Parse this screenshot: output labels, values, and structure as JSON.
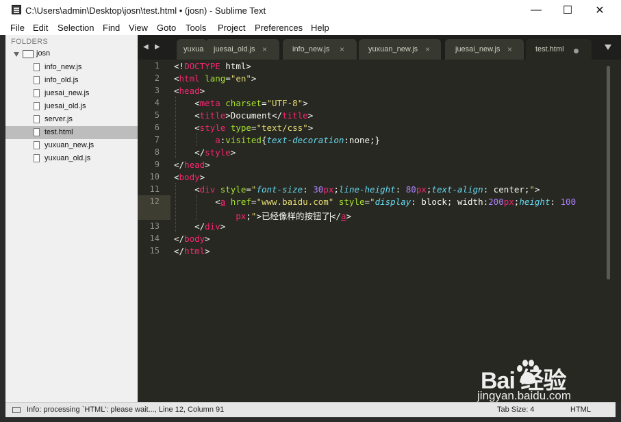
{
  "window": {
    "title": "C:\\Users\\admin\\Desktop\\josn\\test.html • (josn) - Sublime Text",
    "minimize": "—",
    "maximize": "☐",
    "close": "✕"
  },
  "menu": [
    "File",
    "Edit",
    "Selection",
    "Find",
    "View",
    "Goto",
    "Tools",
    "Project",
    "Preferences",
    "Help"
  ],
  "sidebar": {
    "header": "FOLDERS",
    "root": "josn",
    "files": [
      {
        "name": "info_new.js"
      },
      {
        "name": "info_old.js"
      },
      {
        "name": "juesai_new.js"
      },
      {
        "name": "juesai_old.js"
      },
      {
        "name": "server.js"
      },
      {
        "name": "test.html",
        "selected": true
      },
      {
        "name": "yuxuan_new.js"
      },
      {
        "name": "yuxuan_old.js"
      }
    ]
  },
  "tabs": [
    {
      "label": "yuxua",
      "close": ""
    },
    {
      "label": "juesai_old.js",
      "close": "×"
    },
    {
      "label": "info_new.js",
      "close": "×"
    },
    {
      "label": "yuxuan_new.js",
      "close": "×"
    },
    {
      "label": "juesai_new.js",
      "close": "×"
    },
    {
      "label": "test.html",
      "close": "",
      "active": true,
      "dirty": true
    }
  ],
  "tab_nav": {
    "prev": "◀",
    "next": "▶"
  },
  "editor": {
    "line_numbers": [
      "1",
      "2",
      "3",
      "4",
      "5",
      "6",
      "7",
      "8",
      "9",
      "10",
      "11",
      "12",
      "",
      "13",
      "14",
      "15"
    ],
    "current_line": 12,
    "lines": [
      [
        [
          "plain",
          "<!"
        ],
        [
          "tag",
          "DOCTYPE"
        ],
        [
          "plain",
          " html>"
        ]
      ],
      [
        [
          "plain",
          "<"
        ],
        [
          "tag",
          "html"
        ],
        [
          "plain",
          " "
        ],
        [
          "attr",
          "lang"
        ],
        [
          "plain",
          "="
        ],
        [
          "str",
          "\"en\""
        ],
        [
          "plain",
          ">"
        ]
      ],
      [
        [
          "plain",
          "<"
        ],
        [
          "tag",
          "head"
        ],
        [
          "plain",
          ">"
        ]
      ],
      [
        [
          "plain",
          "    <"
        ],
        [
          "tag",
          "meta"
        ],
        [
          "plain",
          " "
        ],
        [
          "attr",
          "charset"
        ],
        [
          "plain",
          "="
        ],
        [
          "str",
          "\"UTF-8\""
        ],
        [
          "plain",
          ">"
        ]
      ],
      [
        [
          "plain",
          "    <"
        ],
        [
          "tag",
          "title"
        ],
        [
          "plain",
          ">Document</"
        ],
        [
          "tag",
          "title"
        ],
        [
          "plain",
          ">"
        ]
      ],
      [
        [
          "plain",
          "    <"
        ],
        [
          "tag",
          "style"
        ],
        [
          "plain",
          " "
        ],
        [
          "attr",
          "type"
        ],
        [
          "plain",
          "="
        ],
        [
          "str",
          "\"text/css\""
        ],
        [
          "plain",
          ">"
        ]
      ],
      [
        [
          "plain",
          "        "
        ],
        [
          "tag",
          "a"
        ],
        [
          "plain",
          ":"
        ],
        [
          "sel",
          "visited"
        ],
        [
          "plain",
          "{"
        ],
        [
          "prop",
          "text-decoration"
        ],
        [
          "plain",
          ":none;}"
        ]
      ],
      [
        [
          "plain",
          "    </"
        ],
        [
          "tag",
          "style"
        ],
        [
          "plain",
          ">"
        ]
      ],
      [
        [
          "plain",
          "</"
        ],
        [
          "tag",
          "head"
        ],
        [
          "plain",
          ">"
        ]
      ],
      [
        [
          "plain",
          "<"
        ],
        [
          "tag",
          "body"
        ],
        [
          "plain",
          ">"
        ]
      ],
      [
        [
          "plain",
          "    <"
        ],
        [
          "tag",
          "div"
        ],
        [
          "plain",
          " "
        ],
        [
          "attr",
          "style"
        ],
        [
          "plain",
          "="
        ],
        [
          "str",
          "\""
        ],
        [
          "prop",
          "font-size"
        ],
        [
          "plain",
          ": "
        ],
        [
          "num",
          "30"
        ],
        [
          "tag",
          "px"
        ],
        [
          "plain",
          ";"
        ],
        [
          "prop",
          "line-height"
        ],
        [
          "plain",
          ": "
        ],
        [
          "num",
          "80"
        ],
        [
          "tag",
          "px"
        ],
        [
          "plain",
          ";"
        ],
        [
          "prop",
          "text-align"
        ],
        [
          "plain",
          ": center;"
        ],
        [
          "str",
          "\""
        ],
        [
          "plain",
          ">"
        ]
      ],
      [
        [
          "plain",
          "        <"
        ],
        [
          "tagu",
          "a"
        ],
        [
          "plain",
          " "
        ],
        [
          "attr",
          "href"
        ],
        [
          "plain",
          "="
        ],
        [
          "str",
          "\"www.baidu.com\""
        ],
        [
          "plain",
          " "
        ],
        [
          "attr",
          "style"
        ],
        [
          "plain",
          "="
        ],
        [
          "str",
          "\""
        ],
        [
          "prop",
          "display"
        ],
        [
          "plain",
          ": block; width:"
        ],
        [
          "num",
          "200"
        ],
        [
          "tag",
          "px"
        ],
        [
          "plain",
          ";"
        ],
        [
          "prop",
          "height"
        ],
        [
          "plain",
          ": "
        ],
        [
          "num",
          "100"
        ]
      ],
      [
        [
          "plain",
          "            "
        ],
        [
          "tag",
          "px"
        ],
        [
          "plain",
          ";"
        ],
        [
          "str",
          "\""
        ],
        [
          "plain",
          ">已经像样的按钮了"
        ],
        [
          "cursor",
          ""
        ],
        [
          "plain",
          "</"
        ],
        [
          "tagu",
          "a"
        ],
        [
          "plain",
          ">"
        ]
      ],
      [
        [
          "plain",
          "    </"
        ],
        [
          "tag",
          "div"
        ],
        [
          "plain",
          ">"
        ]
      ],
      [
        [
          "plain",
          "</"
        ],
        [
          "tag",
          "body"
        ],
        [
          "plain",
          ">"
        ]
      ],
      [
        [
          "plain",
          "</"
        ],
        [
          "tag",
          "html"
        ],
        [
          "plain",
          ">"
        ]
      ]
    ]
  },
  "status": {
    "text": "Info: processing `HTML': please wait..., Line 12, Column 91",
    "tab_size": "Tab Size: 4",
    "syntax": "HTML"
  },
  "watermark": {
    "logo": "Bai 经验",
    "url": "jingyan.baidu.com"
  }
}
